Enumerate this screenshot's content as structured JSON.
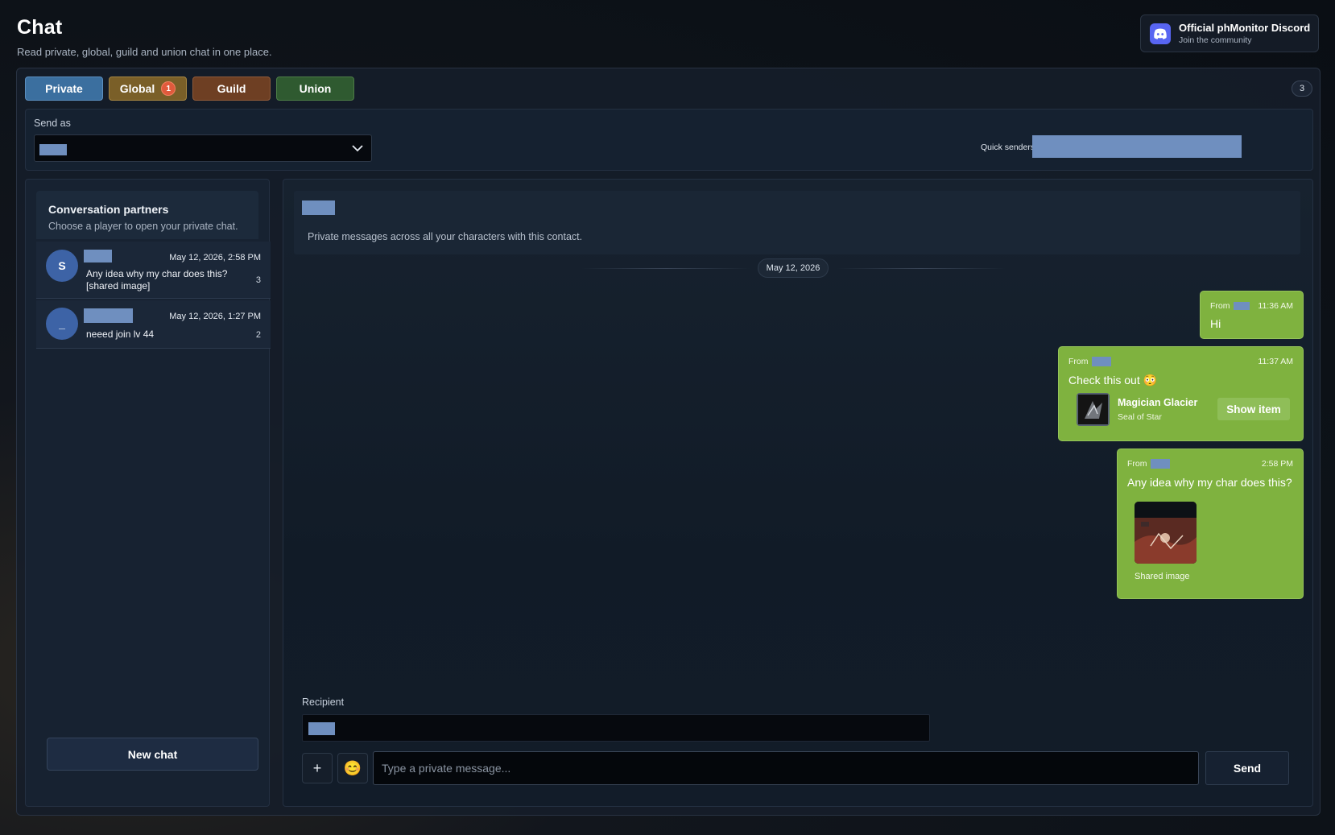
{
  "header": {
    "title": "Chat",
    "subtitle": "Read private, global, guild and union chat in one place."
  },
  "discord": {
    "title": "Official phMonitor Discord",
    "subtitle": "Join the community",
    "icon": "discord-icon",
    "accent": "#5865f2"
  },
  "tabs": [
    {
      "label": "Private",
      "active": true
    },
    {
      "label": "Global",
      "badge": "1"
    },
    {
      "label": "Guild"
    },
    {
      "label": "Union"
    }
  ],
  "tab_count": "3",
  "send_as": {
    "label": "Send as",
    "quick_senders_label": "Quick senders"
  },
  "sidebar": {
    "title": "Conversation partners",
    "subtitle": "Choose a player to open your private chat.",
    "partners": [
      {
        "avatar": "S",
        "date": "May 12, 2026, 2:58 PM",
        "message": "Any idea why my char does this? [shared image]",
        "count": "3"
      },
      {
        "avatar": "_",
        "date": "May 12, 2026, 1:27 PM",
        "message": "neeed join lv 44",
        "count": "2"
      }
    ],
    "new_chat_label": "New chat"
  },
  "chat": {
    "description": "Private messages across all your characters with this contact.",
    "date_divider": "May 12, 2026",
    "messages": [
      {
        "from": "From",
        "time": "11:36 AM",
        "text": "Hi"
      },
      {
        "from": "From",
        "time": "11:37 AM",
        "text": "Check this out 😳",
        "item": {
          "name": "Magician Glacier",
          "sub": "Seal of Star",
          "button": "Show item"
        }
      },
      {
        "from": "From",
        "time": "2:58 PM",
        "text": "Any idea why my char does this?",
        "image_caption": "Shared image"
      }
    ],
    "bubble_color": "#7fb23f"
  },
  "composer": {
    "recipient_label": "Recipient",
    "add_label": "+",
    "emoji_label": "😊",
    "placeholder": "Type a private message...",
    "send_label": "Send"
  }
}
